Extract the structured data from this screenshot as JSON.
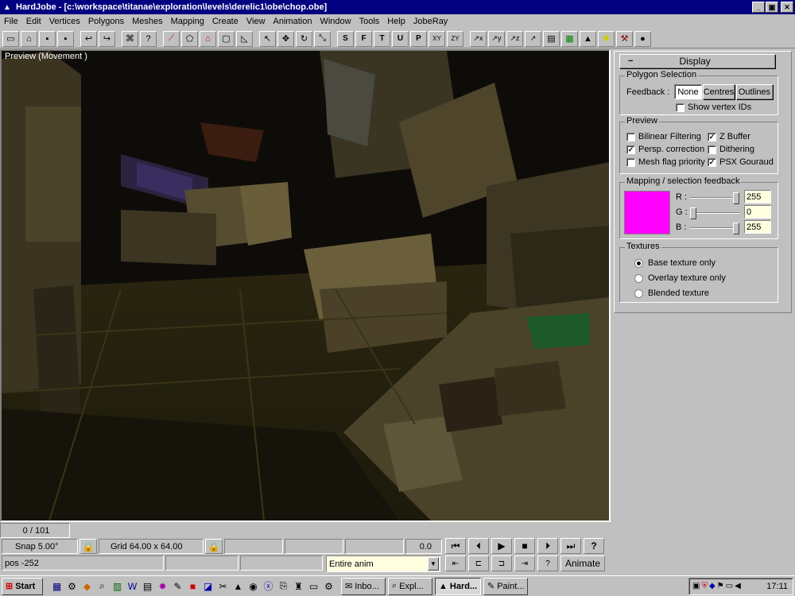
{
  "window": {
    "title": "HardJobe - [c:\\workspace\\titanae\\exploration\\levels\\derelic1\\obe\\chop.obe]",
    "minimize": "_",
    "restore": "▣",
    "close": "✕"
  },
  "menu": [
    "File",
    "Edit",
    "Vertices",
    "Polygons",
    "Meshes",
    "Mapping",
    "Create",
    "View",
    "Animation",
    "Window",
    "Tools",
    "Help",
    "JobeRay"
  ],
  "toolbar": {
    "file_icons": [
      "new-file-icon",
      "open-folder-icon",
      "save-icon",
      "save-all-icon"
    ],
    "edit_icons": [
      "undo-icon",
      "redo-icon"
    ],
    "letters": [
      "S",
      "F",
      "T",
      "U",
      "P",
      "XY",
      "ZY"
    ]
  },
  "preview": {
    "label": "Preview (Movement )"
  },
  "panel": {
    "header_label": "Display",
    "collapse_glyph": "−",
    "polygon_selection": {
      "title": "Polygon Selection",
      "feedback_label": "Feedback :",
      "btn_none": "None",
      "btn_centres": "Centres",
      "btn_outlines": "Outlines",
      "show_vertex_ids": "Show vertex IDs"
    },
    "preview": {
      "title": "Preview",
      "bilinear": "Bilinear Filtering",
      "zbuffer": "Z Buffer",
      "persp": "Persp. correction",
      "dithering": "Dithering",
      "meshflag": "Mesh flag priority",
      "psx": "PSX Gouraud"
    },
    "mapping": {
      "title": "Mapping / selection feedback",
      "color": "#ff00ff",
      "r_label": "R :",
      "g_label": "G :",
      "b_label": "B :",
      "r": "255",
      "g": "0",
      "b": "255",
      "r_level": 1.0,
      "g_level": 0.0,
      "b_level": 1.0
    },
    "textures": {
      "title": "Textures",
      "base": "Base texture only",
      "overlay": "Overlay texture only",
      "blended": "Blended texture"
    }
  },
  "status": {
    "frame": "0 / 101",
    "snap": "Snap 5.00°",
    "grid": "Grid 64.00 x 64.00",
    "time": "0.0",
    "pos": "pos -252",
    "anim_select": "Entire anim",
    "animate_btn": "Animate"
  },
  "taskbar": {
    "start": "Start",
    "tasks": [
      "Inbo...",
      "Expl...",
      "Hard...",
      "Paint..."
    ],
    "clock": "17:11"
  }
}
